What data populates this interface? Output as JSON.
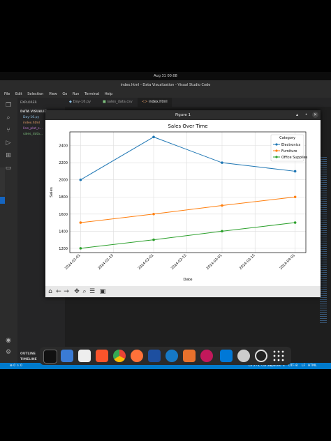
{
  "system": {
    "datetime": "Aug 31 00:08"
  },
  "window": {
    "title": "index.html - Data Visualization - Visual Studio Code"
  },
  "menu": [
    "File",
    "Edit",
    "Selection",
    "View",
    "Go",
    "Run",
    "Terminal",
    "Help"
  ],
  "explorer": {
    "header": "EXPLORER",
    "folder": "DATA VISUALIZ...",
    "files": [
      "Day-16.py",
      "index.html",
      "line_plot_s...",
      "sales_data..."
    ],
    "outline": "OUTLINE",
    "timeline": "TIMELINE"
  },
  "tabs": [
    {
      "label": "Day-16.py",
      "active": false
    },
    {
      "label": "sales_data.csv",
      "active": false
    },
    {
      "label": "index.html",
      "active": true
    }
  ],
  "statusbar": {
    "left": "⊗ 0 ⚠ 0",
    "ln_col": "Ln 273, Col 26",
    "spaces": "Spaces: 4",
    "encoding": "UTF-8",
    "eol": "LF",
    "lang": "HTML"
  },
  "figure": {
    "title": "Figure 1"
  },
  "chart_data": {
    "type": "line",
    "title": "Sales Over Time",
    "xlabel": "Date",
    "ylabel": "Sales",
    "x": [
      "2024-01-01",
      "2024-02-01",
      "2024-03-01",
      "2024-04-01"
    ],
    "x_ticks": [
      "2024-01-01",
      "2024-01-15",
      "2024-02-01",
      "2024-02-15",
      "2024-03-01",
      "2024-03-15",
      "2024-04-01"
    ],
    "y_ticks": [
      1200,
      1400,
      1600,
      1800,
      2000,
      2200,
      2400
    ],
    "ylim": [
      1150,
      2560
    ],
    "grid": true,
    "legend": {
      "title": "Category",
      "placement": "top-right"
    },
    "series": [
      {
        "name": "Electronics",
        "color": "#1f77b4",
        "values": [
          2000,
          2500,
          2200,
          2100
        ]
      },
      {
        "name": "Furniture",
        "color": "#ff7f0e",
        "values": [
          1500,
          1600,
          1700,
          1800
        ]
      },
      {
        "name": "Office Supplies",
        "color": "#2ca02c",
        "values": [
          1200,
          1300,
          1400,
          1500
        ]
      }
    ]
  },
  "dock_apps": [
    "terminal-icon",
    "files-icon",
    "text-editor-icon",
    "brave-icon",
    "chrome-icon",
    "firefox-icon",
    "malwarebytes-icon",
    "wireshark-icon",
    "burpsuite-icon",
    "cherrytree-icon",
    "vscode-icon",
    "settings-icon",
    "obs-icon",
    "app-grid-icon"
  ]
}
